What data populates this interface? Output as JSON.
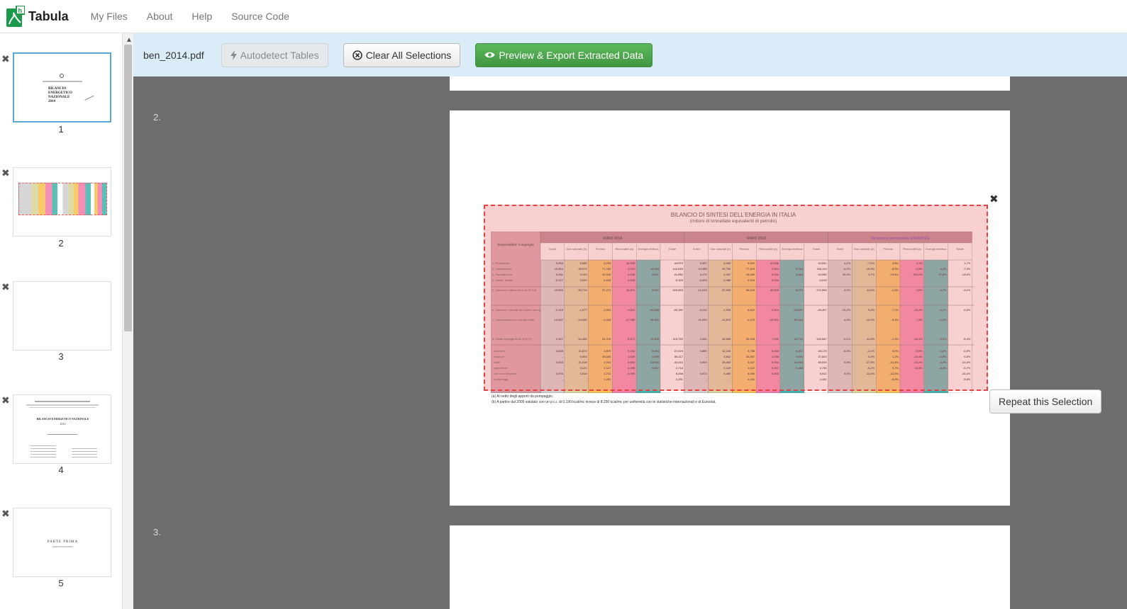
{
  "navbar": {
    "brand": "Tabula",
    "links": [
      "My Files",
      "About",
      "Help",
      "Source Code"
    ]
  },
  "toolbar": {
    "filename": "ben_2014.pdf",
    "autodetect_label": "Autodetect Tables",
    "clear_label": "Clear All Selections",
    "preview_label": "Preview & Export Extracted Data"
  },
  "sidebar": {
    "thumbnails": [
      {
        "number": "1",
        "title_lines": [
          "BILANCIO",
          "ENERGETICO",
          "NAZIONALE",
          "2014"
        ]
      },
      {
        "number": "2"
      },
      {
        "number": "3"
      },
      {
        "number": "4",
        "heading": "BILANCIO ENERGETICO NAZIONALE",
        "year": "2014"
      },
      {
        "number": "5",
        "heading": "PARTE PRIMA"
      }
    ]
  },
  "main": {
    "page_labels": [
      "2.",
      "3."
    ],
    "repeat_selection_label": "Repeat this Selection",
    "table": {
      "title": "BILANCIO DI SINTESI DELL'ENERGIA IN ITALIA",
      "subtitle": "(milioni di tonnellate equivalenti di petrolio)",
      "row_header": "Disponibilita' e impieghi",
      "groups": [
        "ANNO 2014",
        "ANNO 2013",
        "Variazione percentuale (2014/2013)"
      ],
      "columns": [
        "Solidi",
        "Gas naturale (b)",
        "Petrolio",
        "Rinnovabili (a)",
        "Energia elettrica",
        "Totale"
      ],
      "rows": [
        {
          "label": "1. Produzione",
          "v": [
            "0,353",
            "5,856",
            "5,765",
            "32,605",
            "-",
            "44,579",
            "0,357",
            "6,336",
            "5,502",
            "31,636",
            "-",
            "43,831",
            "-1,1%",
            "-7,6%",
            "4,8%",
            "3,1%",
            "",
            "1,7%"
          ]
        },
        {
          "label": "2. Importazione",
          "v": [
            "13,464",
            "45,671",
            "71,190",
            "2,224",
            "10,284",
            "142,833",
            "13,485",
            "50,756",
            "77,815",
            "2,304",
            "9,754",
            "154,114",
            "-0,2%",
            "-10,0%",
            "-8,5%",
            "-3,5%",
            "5,4%",
            "-7,3%"
          ]
        },
        {
          "label": "3. Esportazione",
          "v": [
            "0,241",
            "0,194",
            "20,310",
            "0,140",
            "0,667",
            "21,552",
            "0,173",
            "0,187",
            "24,060",
            "0,052",
            "0,484",
            "24,956",
            "39,3%",
            "3,7%",
            "-15,6%",
            "169,2%",
            "37,8%",
            "-13,6%"
          ]
        },
        {
          "label": "4. Variaz. scorte",
          "v": [
            "-0,117",
            "0,620",
            "-0,626",
            "0,018",
            "-",
            "-0,105",
            "-0,494",
            "-0,488",
            "0,914",
            "0,053",
            "-",
            "-0,015",
            "",
            "",
            "",
            "",
            "",
            ""
          ]
        },
        {
          "label": "5. Consumo interno lordo (1+2-3-4)",
          "v": [
            "13,693",
            "50,713",
            "57,271",
            "34,671",
            "9,617",
            "165,965",
            "14,163",
            "57,393",
            "58,343",
            "33,825",
            "9,270",
            "172,994",
            "-3,3%",
            "-11,6%",
            "-1,8%",
            "2,5%",
            "3,7%",
            "-4,1%"
          ]
        },
        {
          "label": "6. Consumi e perdite del settore energ.",
          "v": [
            "-0,119",
            "-1,677",
            "-3,551",
            "-0,011",
            "-40,838",
            "-46,196",
            "-0,142",
            "-1,533",
            "-3,822",
            "-0,013",
            "-40,897",
            "-46,407",
            "-16,2%",
            "9,4%",
            "-7,1%",
            "-15,4%",
            "-0,1%",
            "-0,5%"
          ]
        },
        {
          "label": "7. Trasformazioni in energia elettr.",
          "v": [
            "-10,647",
            "-14,650",
            "-2,344",
            "-27,789",
            "55,430",
            "",
            "-11,090",
            "-16,876",
            "-2,476",
            "-25,901",
            "56,343",
            "",
            "-4,0%",
            "-13,2%",
            "-5,3%",
            "7,3%",
            "-1,6%",
            ""
          ]
        },
        {
          "label": "8. Totale impieghi finali (5+6+7)",
          "v": [
            "2,927",
            "34,386",
            "51,376",
            "6,871",
            "24,209",
            "119,769",
            "2,931",
            "38,984",
            "52,045",
            "7,911",
            "24,716",
            "126,587",
            "-0,1%",
            "-11,8%",
            "-1,3%",
            "-13,1%",
            "-2,1%",
            "-5,4%"
          ]
        },
        {
          "label": "- industria",
          "v": [
            "2,848",
            "11,874",
            "3,979",
            "0,032",
            "9,194",
            "27,929",
            "2,856",
            "12,130",
            "3,788",
            "0,034",
            "9,367",
            "28,175",
            "-0,3%",
            "-2,1%",
            "5,0%",
            "-5,9%",
            "-1,8%",
            "-0,9%"
          ]
        },
        {
          "label": "- trasporti",
          "v": [
            "-",
            "0,863",
            "35,326",
            "1,029",
            "0,899",
            "38,117",
            "-",
            "0,812",
            "34,897",
            "1,188",
            "0,926",
            "37,823",
            "",
            "6,3%",
            "1,2%",
            "-13,4%",
            "-2,9%",
            "0,8%"
          ]
        },
        {
          "label": "- civile",
          "v": [
            "0,003",
            "21,018",
            "2,941",
            "5,802",
            "13,653",
            "43,416",
            "0,003",
            "25,463",
            "3,427",
            "6,682",
            "13,935",
            "49,510",
            "0,0%",
            "-17,5%",
            "-14,2%",
            "-13,2%",
            "-2,0%",
            "-12,3%"
          ]
        },
        {
          "label": "- agricoltura",
          "v": [
            "",
            "0,121",
            "2,127",
            "0,008",
            "0,462",
            "2,718",
            "",
            "0,129",
            "2,112",
            "0,007",
            "0,488",
            "2,736",
            "",
            "-6,2%",
            "0,7%",
            "14,3%",
            "-5,3%",
            "-0,7%"
          ]
        },
        {
          "label": "- usi non energetici",
          "v": [
            "0,076",
            "0,510",
            "4,712",
            "0,000",
            "-",
            "5,298",
            "0,072",
            "0,450",
            "5,390",
            "0,000",
            "-",
            "5,912",
            "5,6%",
            "13,3%",
            "-12,6%",
            "",
            "",
            "-10,4%"
          ]
        },
        {
          "label": "- bunkeraggi",
          "v": [
            "-",
            "-",
            "2,291",
            "-",
            "-",
            "2,291",
            "-",
            "-",
            "2,431",
            "-",
            "-",
            "2,431",
            "",
            "",
            "-5,8%",
            "",
            "",
            "-5,8%"
          ]
        }
      ],
      "footnotes": [
        "(a) Al netto degli apporti da pompaggio.",
        "(b) A partire dal 2005 valutato con un p.c.i. di 0,190 kcal/mc invece di 8.250 kcal/mc per uniformità con le statistiche internazionali e di Eurostat."
      ]
    },
    "thumb5_subtitle": "ANALISI DI QUADRO",
    "colors": {
      "solidi": "#cfcfcf",
      "gas": "#d9d49a",
      "petrolio": "#f6c24f",
      "rinnovabili": "#f37ba9",
      "elettrica": "#3eb3ad",
      "totale": "#ffffff",
      "header": "#d39aa5",
      "header_dark": "#b07583"
    }
  }
}
